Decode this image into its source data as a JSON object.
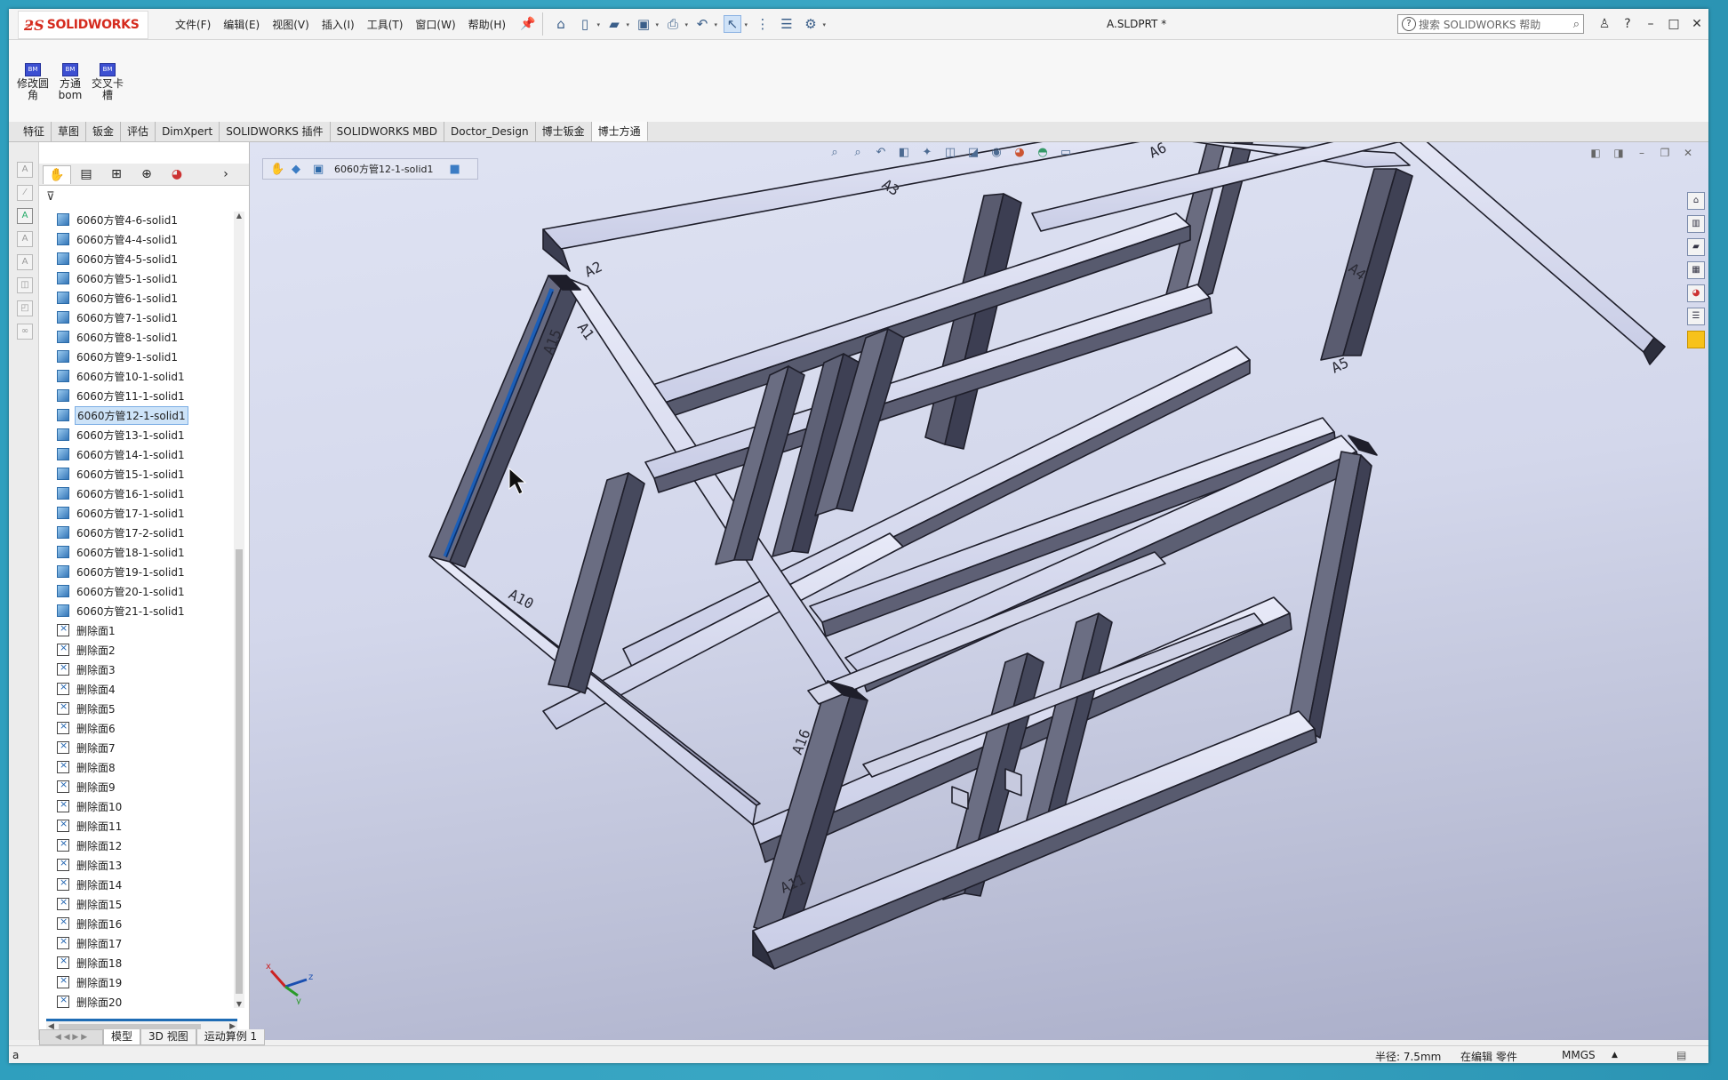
{
  "app": {
    "brand_ds": "ƻS",
    "brand_name": "SOLIDWORKS",
    "document_title": "A.SLDPRT *"
  },
  "menu": [
    "文件(F)",
    "编辑(E)",
    "视图(V)",
    "插入(I)",
    "工具(T)",
    "窗口(W)",
    "帮助(H)"
  ],
  "help_search": {
    "placeholder": "搜索 SOLIDWORKS 帮助"
  },
  "command_buttons": [
    {
      "icon": "BM",
      "label_line1": "修改圆",
      "label_line2": "角"
    },
    {
      "icon": "BM",
      "label_line1": "方通",
      "label_line2": "bom"
    },
    {
      "icon": "BM",
      "label_line1": "交叉卡",
      "label_line2": "槽"
    }
  ],
  "command_tabs": [
    "特征",
    "草图",
    "钣金",
    "评估",
    "DimXpert",
    "SOLIDWORKS 插件",
    "SOLIDWORKS MBD",
    "Doctor_Design",
    "博士钣金",
    "博士方通"
  ],
  "active_command_tab": "博士方通",
  "feature_tree": {
    "bodies": [
      "6060方管4-6-solid1",
      "6060方管4-4-solid1",
      "6060方管4-5-solid1",
      "6060方管5-1-solid1",
      "6060方管6-1-solid1",
      "6060方管7-1-solid1",
      "6060方管8-1-solid1",
      "6060方管9-1-solid1",
      "6060方管10-1-solid1",
      "6060方管11-1-solid1",
      "6060方管12-1-solid1",
      "6060方管13-1-solid1",
      "6060方管14-1-solid1",
      "6060方管15-1-solid1",
      "6060方管16-1-solid1",
      "6060方管17-1-solid1",
      "6060方管17-2-solid1",
      "6060方管18-1-solid1",
      "6060方管19-1-solid1",
      "6060方管20-1-solid1",
      "6060方管21-1-solid1"
    ],
    "delete_faces": [
      "删除面1",
      "删除面2",
      "删除面3",
      "删除面4",
      "删除面5",
      "删除面6",
      "删除面7",
      "删除面8",
      "删除面9",
      "删除面10",
      "删除面11",
      "删除面12",
      "删除面13",
      "删除面14",
      "删除面15",
      "删除面16",
      "删除面17",
      "删除面18",
      "删除面19",
      "删除面20"
    ],
    "selected": "6060方管12-1-solid1"
  },
  "breadcrumb": {
    "label": "6060方管12-1-solid1"
  },
  "model_labels": [
    "A1",
    "A2",
    "A3",
    "A4",
    "A5",
    "A6",
    "A10",
    "A11",
    "A15",
    "A16"
  ],
  "triad": {
    "x": "x",
    "y": "y",
    "z": "z"
  },
  "bottom_tabs": [
    "模型",
    "3D 视图",
    "运动算例 1"
  ],
  "status": {
    "left": "a",
    "radius": "半径: 7.5mm",
    "mode": "在编辑 零件",
    "units": "MMGS"
  }
}
